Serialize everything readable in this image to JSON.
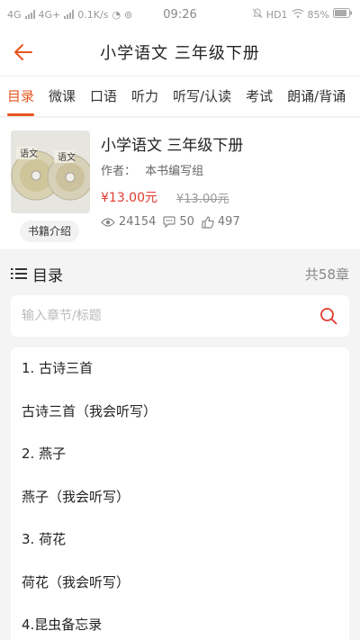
{
  "status_bar": {
    "left_text": "4G",
    "network2": "4G+",
    "speed": "0.1K/s",
    "time": "09:26",
    "hd": "HD1",
    "battery": "85%"
  },
  "header": {
    "title": "小学语文  三年级下册"
  },
  "tabs": [
    {
      "label": "目录",
      "active": true
    },
    {
      "label": "微课"
    },
    {
      "label": "口语"
    },
    {
      "label": "听力"
    },
    {
      "label": "听写/认读"
    },
    {
      "label": "考试"
    },
    {
      "label": "朗诵/背诵"
    }
  ],
  "book": {
    "title": "小学语文  三年级下册",
    "author_label": "作者：",
    "author": "本书编写组",
    "price": "¥13.00元",
    "original_price": "¥13.00元",
    "views": "24154",
    "comments": "50",
    "likes": "497",
    "intro_button": "书籍介绍",
    "cover_text": "语文"
  },
  "catalog": {
    "title": "目录",
    "count": "共58章",
    "search_placeholder": "输入章节/标题",
    "items": [
      "1. 古诗三首",
      "古诗三首（我会听写）",
      "2. 燕子",
      "燕子（我会听写）",
      "3. 荷花",
      "荷花（我会听写）",
      "4.昆虫备忘录"
    ]
  },
  "colors": {
    "accent": "#e8541e",
    "price": "#e03a2f"
  }
}
